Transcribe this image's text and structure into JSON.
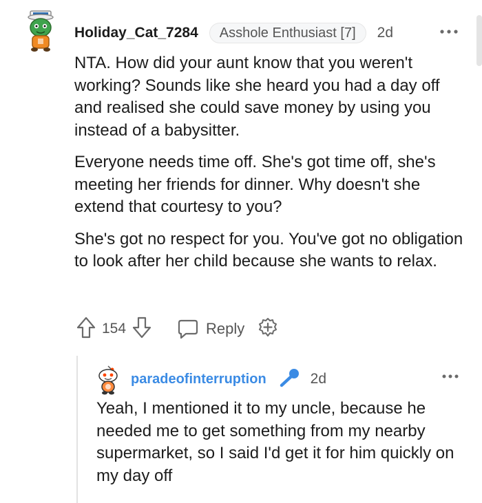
{
  "comment": {
    "username": "Holiday_Cat_7284",
    "flair": "Asshole Enthusiast [7]",
    "timestamp": "2d",
    "avatar_icon": "snoo-avatar-sailor-hat-icon",
    "paragraphs": [
      "NTA. How did your aunt know that you weren't working? Sounds like she heard you had a day off and realised she could save money by using you instead of a babysitter.",
      "Everyone needs time off. She's got time off, she's meeting her friends for dinner. Why doesn't she extend that courtesy to you?",
      "She's got no respect for you. You've got no obligation to look after her child because she wants to relax."
    ],
    "actions": {
      "vote_count": "154",
      "reply_label": "Reply"
    }
  },
  "reply": {
    "username": "paradeofinterruption",
    "timestamp": "2d",
    "badge_icon": "microphone-icon",
    "avatar_icon": "snoo-avatar-icon",
    "text": "Yeah, I mentioned it to my uncle, because he needed me to get something from my nearby supermarket, so I said I'd get it for him quickly on my day off"
  },
  "colors": {
    "accent_blue": "#3b8be4",
    "text": "#1c1c1c",
    "meta": "#555555",
    "thread_line": "#e2e2e2"
  }
}
